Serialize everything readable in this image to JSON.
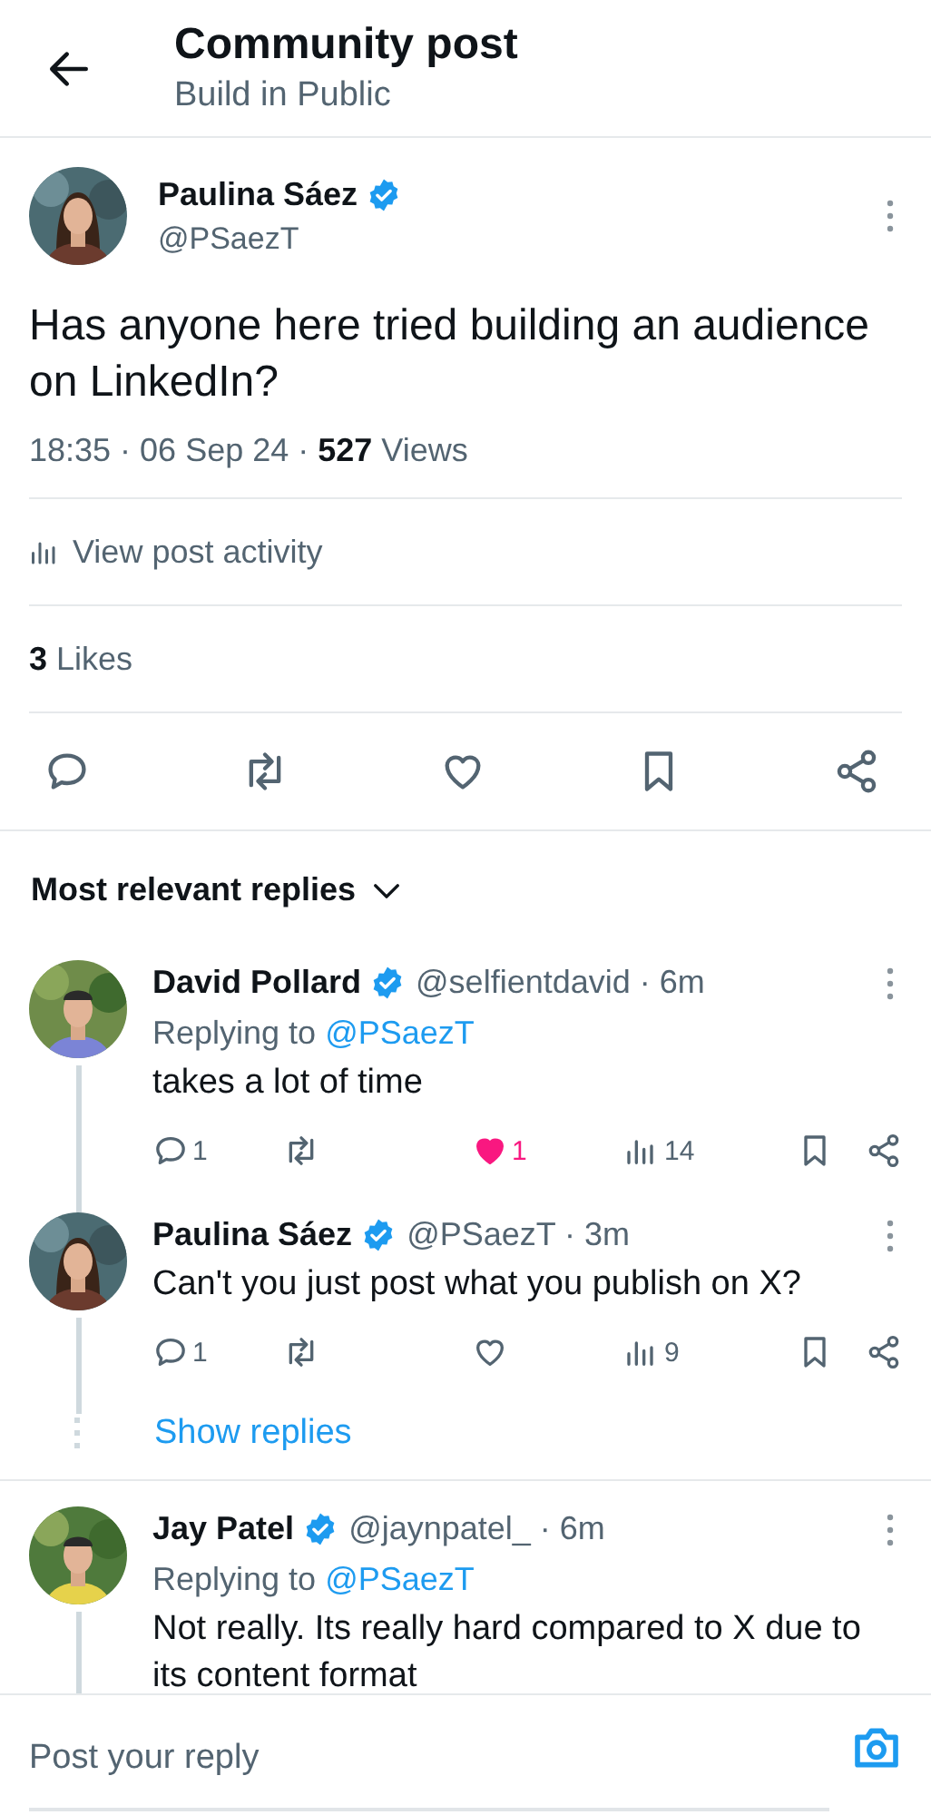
{
  "header": {
    "title": "Community post",
    "subtitle": "Build in Public"
  },
  "post": {
    "author": {
      "name": "Paulina Sáez",
      "verified": true,
      "handle": "@PSaezT"
    },
    "text": "Has anyone here tried building an audience on LinkedIn?",
    "meta": "18:35 · 06 Sep 24 · **527** Views",
    "activity_link": "View post activity",
    "likes": "**3** Likes"
  },
  "replies_header": "Most relevant replies",
  "replies": [
    {
      "name": "David Pollard",
      "verified": true,
      "handle_time": "@selfientdavid · 6m",
      "replying_to": {
        "label": "Replying to",
        "handle": "@PSaezT"
      },
      "text": "takes a lot of time",
      "stats": {
        "replies": "1",
        "likes": "1",
        "liked": true,
        "views": "14"
      },
      "thread_line": true
    },
    {
      "name": "Paulina Sáez",
      "verified": true,
      "handle_time": "@PSaezT · 3m",
      "text": "Can't you just post what you publish on X?",
      "stats": {
        "replies": "1",
        "liked": false,
        "views": "9"
      },
      "thread_line": true,
      "show_replies": "Show replies"
    },
    {
      "name": "Jay Patel",
      "verified": true,
      "handle_time": "@jaynpatel_ · 6m",
      "replying_to": {
        "label": "Replying to",
        "handle": "@PSaezT"
      },
      "text": "Not really. Its really hard compared to X due to its content format",
      "thread_line": true
    }
  ],
  "reply_bar": {
    "placeholder": "Post your reply"
  }
}
